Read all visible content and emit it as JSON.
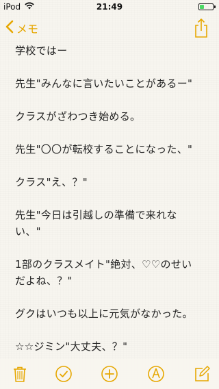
{
  "status_bar": {
    "device": "iPod",
    "time": "21:49",
    "battery_level": 0.35,
    "wifi_icon": "wifi-icon",
    "battery_icon": "battery-icon"
  },
  "nav": {
    "back_label": "メモ",
    "back_icon": "chevron-left-icon",
    "share_icon": "share-icon"
  },
  "note": {
    "lines": [
      "学校ではー",
      "",
      "先生\"みんなに言いたいことがあるー\"",
      "",
      "クラスがざわつき始める。",
      "",
      "先生\"〇〇が転校することになった、\"",
      "",
      "クラス\"え、？\"",
      "",
      "先生\"今日は引越しの準備で来れな",
      "い、\"",
      "",
      "1部のクラスメイト\"絶対、♡♡のせい",
      "だよね、？\"",
      "",
      "グクはいつも以上に元気がなかった。",
      "",
      "☆☆ジミン\"大丈夫、？\""
    ]
  },
  "toolbar": {
    "items": [
      "trash-icon",
      "checkmark-circle-icon",
      "add-circle-icon",
      "sketch-icon",
      "compose-icon"
    ]
  },
  "colors": {
    "accent": "#e6a700",
    "background": "#f7f5ef",
    "text": "#222222",
    "battery": "#4cd964"
  }
}
